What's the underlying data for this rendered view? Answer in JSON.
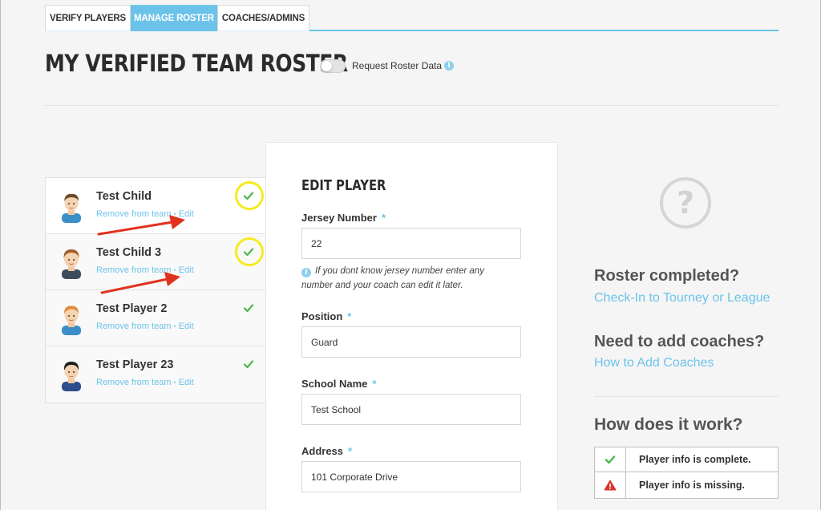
{
  "tabs": [
    {
      "label": "VERIFY PLAYERS",
      "active": false
    },
    {
      "label": "MANAGE ROSTER",
      "active": true
    },
    {
      "label": "COACHES/ADMINS",
      "active": false
    }
  ],
  "header": {
    "title": "MY VERIFIED TEAM ROSTER",
    "toggle_label": "Request Roster Data",
    "toggle_on": false,
    "info_glyph": "i"
  },
  "players": [
    {
      "name": "Test Child",
      "remove_label": "Remove from team",
      "edit_label": "Edit",
      "status": "complete",
      "highlighted": true
    },
    {
      "name": "Test Child 3",
      "remove_label": "Remove from team",
      "edit_label": "Edit",
      "status": "complete",
      "highlighted": true
    },
    {
      "name": "Test Player 2",
      "remove_label": "Remove from team",
      "edit_label": "Edit",
      "status": "complete",
      "highlighted": false
    },
    {
      "name": "Test Player 23",
      "remove_label": "Remove from team",
      "edit_label": "Edit",
      "status": "complete",
      "highlighted": false
    }
  ],
  "link_separator": "•",
  "edit_form": {
    "title": "EDIT PLAYER",
    "required_mark": "*",
    "jersey": {
      "label": "Jersey Number",
      "value": "22"
    },
    "jersey_help": "If you dont know jersey number enter any number and your coach can edit it later.",
    "position": {
      "label": "Position",
      "value": "Guard"
    },
    "school": {
      "label": "School Name",
      "value": "Test School"
    },
    "address": {
      "label": "Address",
      "value": "101 Corporate Drive"
    }
  },
  "sidebar": {
    "help_glyph": "?",
    "roster_completed": {
      "heading": "Roster completed?",
      "link": "Check-In to Tourney or League"
    },
    "add_coaches": {
      "heading": "Need to add coaches?",
      "link": "How to Add Coaches"
    },
    "how_it_works": "How does it work?",
    "legend": [
      {
        "icon": "check-icon",
        "text": "Player info is complete."
      },
      {
        "icon": "warning-icon",
        "text": "Player info is missing."
      }
    ]
  },
  "colors": {
    "accent": "#6cc3ea",
    "check": "#4cb848",
    "warning": "#d9342b",
    "highlight": "#f4ec20",
    "annotation_arrow": "#e0321e"
  }
}
